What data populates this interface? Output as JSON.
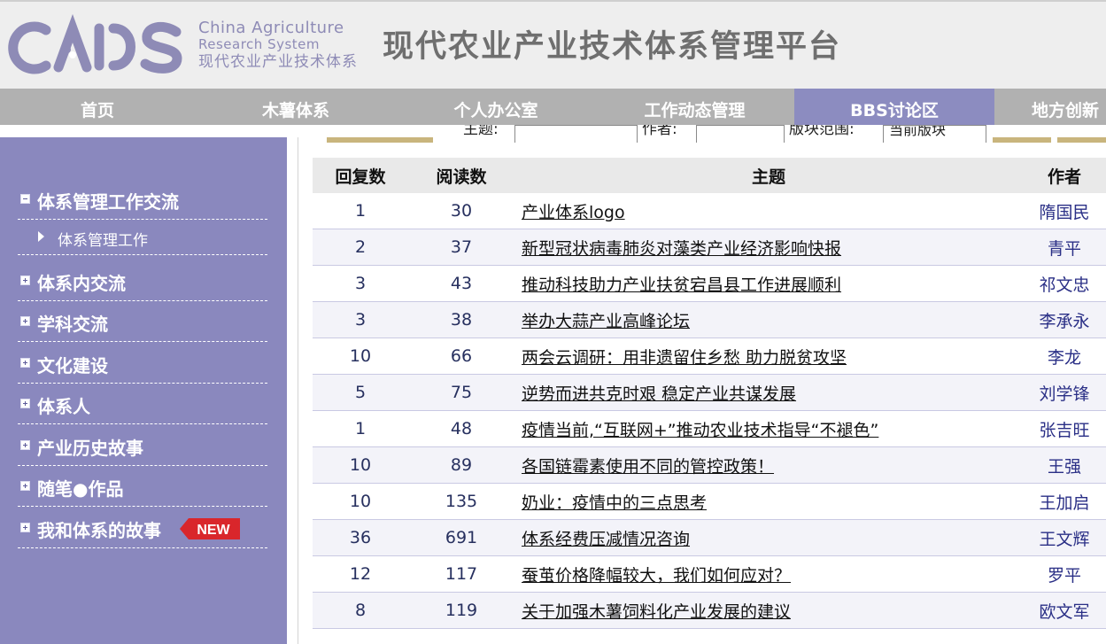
{
  "header": {
    "logo_text": "CARS",
    "logo_en_line1": "China Agriculture",
    "logo_en_line2": "Research System",
    "logo_cn": "现代农业产业技术体系",
    "title": "现代农业产业技术体系管理平台"
  },
  "nav": {
    "items": [
      {
        "label": "首页"
      },
      {
        "label": "木薯体系"
      },
      {
        "label": "个人办公室"
      },
      {
        "label": "工作动态管理"
      },
      {
        "label": "BBS讨论区"
      },
      {
        "label": "地方创新"
      }
    ],
    "active": "BBS讨论区"
  },
  "search": {
    "topic_label": "主题:",
    "author_label": "作者:",
    "scope_label": "版块范围:",
    "scope_value": "当前版块"
  },
  "sidebar": {
    "sections": [
      {
        "label": "体系管理工作交流",
        "expanded": true
      },
      {
        "label": "体系管理工作",
        "sub": true
      },
      {
        "label": "体系内交流"
      },
      {
        "label": "学科交流"
      },
      {
        "label": "文化建设"
      },
      {
        "label": "体系人"
      },
      {
        "label": "产业历史故事"
      },
      {
        "label": "随笔●作品"
      },
      {
        "label": "我和体系的故事"
      }
    ],
    "new_badge": "NEW",
    "badge_color": "#d9262b"
  },
  "table": {
    "headers": {
      "replies": "回复数",
      "reads": "阅读数",
      "topic": "主题",
      "author": "作者"
    },
    "rows": [
      {
        "replies": "1",
        "reads": "30",
        "topic": "产业体系logo",
        "author": "隋国民"
      },
      {
        "replies": "2",
        "reads": "37",
        "topic": "新型冠状病毒肺炎对藻类产业经济影响快报",
        "author": "青平"
      },
      {
        "replies": "3",
        "reads": "43",
        "topic": "推动科技助力产业扶贫宕昌县工作进展顺利",
        "author": "祁文忠"
      },
      {
        "replies": "3",
        "reads": "38",
        "topic": "举办大蒜产业高峰论坛",
        "author": "李承永"
      },
      {
        "replies": "10",
        "reads": "66",
        "topic": "两会云调研：用非遗留住乡愁 助力脱贫攻坚",
        "author": "李龙"
      },
      {
        "replies": "5",
        "reads": "75",
        "topic": "逆势而进共克时艰 稳定产业共谋发展",
        "author": "刘学锋"
      },
      {
        "replies": "1",
        "reads": "48",
        "topic": "疫情当前,“互联网+”推动农业技术指导“不褪色”",
        "author": "张吉旺"
      },
      {
        "replies": "10",
        "reads": "89",
        "topic": "各国链霉素使用不同的管控政策！",
        "author": "王强"
      },
      {
        "replies": "10",
        "reads": "135",
        "topic": "奶业：疫情中的三点思考",
        "author": "王加启"
      },
      {
        "replies": "36",
        "reads": "691",
        "topic": "体系经费压减情况咨询",
        "author": "王文辉"
      },
      {
        "replies": "12",
        "reads": "117",
        "topic": "蚕茧价格降幅较大，我们如何应对？",
        "author": "罗平"
      },
      {
        "replies": "8",
        "reads": "119",
        "topic": "关于加强木薯饲料化产业发展的建议",
        "author": "欧文军"
      }
    ]
  },
  "colors": {
    "nav_bg": "#b1b1b1",
    "nav_active": "#8c8cc0",
    "sidebar_bg": "#8a88be",
    "logo_color": "#8e8bb6"
  }
}
